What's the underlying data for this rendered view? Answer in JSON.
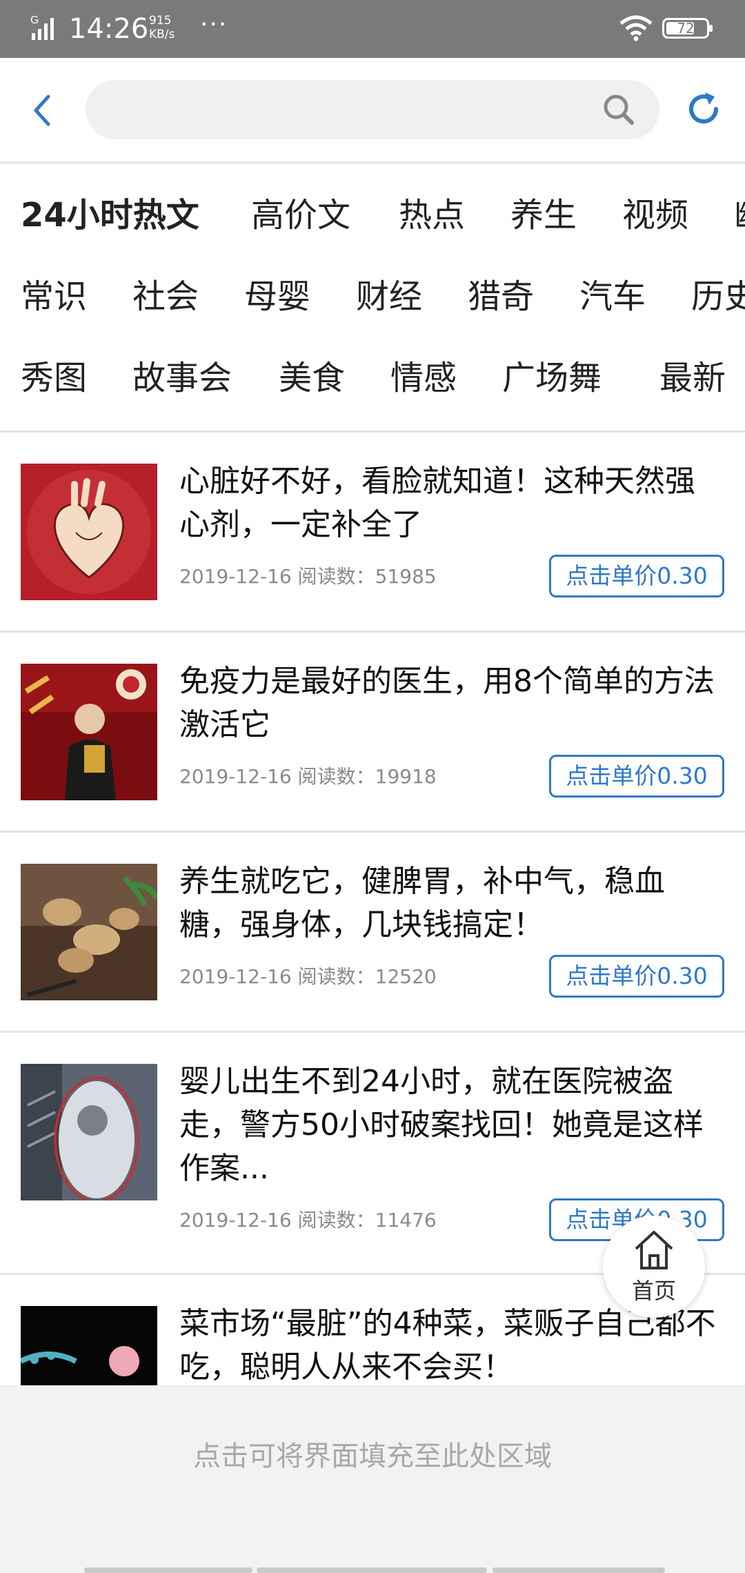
{
  "status_bar": {
    "network": "G",
    "time": "14:26",
    "speed_value": "915",
    "speed_unit": "KB/s",
    "more": "···",
    "battery": "72",
    "battery_level": 0.72
  },
  "search": {
    "placeholder": ""
  },
  "tabs": [
    {
      "label": "24小时热文",
      "active": true
    },
    {
      "label": "高价文"
    },
    {
      "label": "热点"
    },
    {
      "label": "养生"
    },
    {
      "label": "视频"
    },
    {
      "label": "幽"
    },
    {
      "label": "常识"
    },
    {
      "label": "社会"
    },
    {
      "label": "母婴"
    },
    {
      "label": "财经"
    },
    {
      "label": "猎奇"
    },
    {
      "label": "汽车"
    },
    {
      "label": "历史"
    },
    {
      "label": "秀图"
    },
    {
      "label": "故事会"
    },
    {
      "label": "美食"
    },
    {
      "label": "情感"
    },
    {
      "label": "广场舞"
    },
    {
      "label": "最新"
    }
  ],
  "articles": [
    {
      "title": "心脏好不好，看脸就知道！这种天然强心剂，一定补全了",
      "date": "2019-12-16",
      "reads_label": "阅读数：",
      "reads": "51985",
      "price_label": "点击单价0.30",
      "thumb": "heart"
    },
    {
      "title": "免疫力是最好的医生，用8个简单的方法激活它",
      "date": "2019-12-16",
      "reads_label": "阅读数：",
      "reads": "19918",
      "price_label": "点击单价0.30",
      "thumb": "award"
    },
    {
      "title": "养生就吃它，健脾胃，补中气，稳血糖，强身体，几块钱搞定！",
      "date": "2019-12-16",
      "reads_label": "阅读数：",
      "reads": "12520",
      "price_label": "点击单价0.30",
      "thumb": "ginger"
    },
    {
      "title": "婴儿出生不到24小时，就在医院被盗走，警方50小时破案找回！她竟是这样作案...",
      "date": "2019-12-16",
      "reads_label": "阅读数：",
      "reads": "11476",
      "price_label": "点击单价0.30",
      "thumb": "cctv"
    },
    {
      "title": "菜市场“最脏”的4种菜，菜贩子自己都不吃，聪明人从来不会买！",
      "thumb": "flowers"
    }
  ],
  "home_float": {
    "label": "首页"
  },
  "bottom_overlay": {
    "text": "点击可将界面填充至此处区域"
  },
  "colors": {
    "accent": "#2f78c8",
    "statusbar": "#7a7a7a"
  }
}
